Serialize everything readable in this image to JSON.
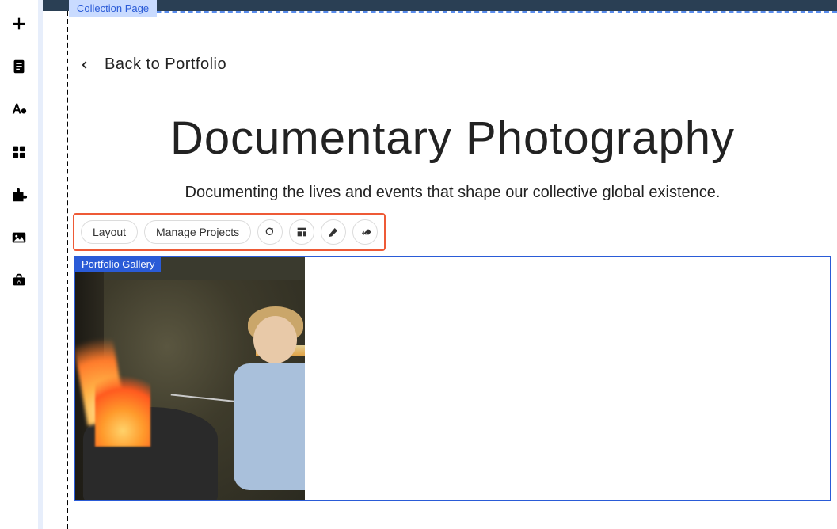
{
  "tags": {
    "collection_page": "Collection Page",
    "portfolio_gallery": "Portfolio Gallery"
  },
  "nav": {
    "back_label": "Back to Portfolio"
  },
  "page": {
    "title": "Documentary Photography",
    "subtitle": "Documenting the lives and events that shape our collective global existence."
  },
  "toolbar": {
    "layout_label": "Layout",
    "manage_label": "Manage Projects"
  },
  "rail": {
    "icons": [
      "plus",
      "page",
      "text-style",
      "grid",
      "plugin",
      "image",
      "briefcase"
    ]
  }
}
